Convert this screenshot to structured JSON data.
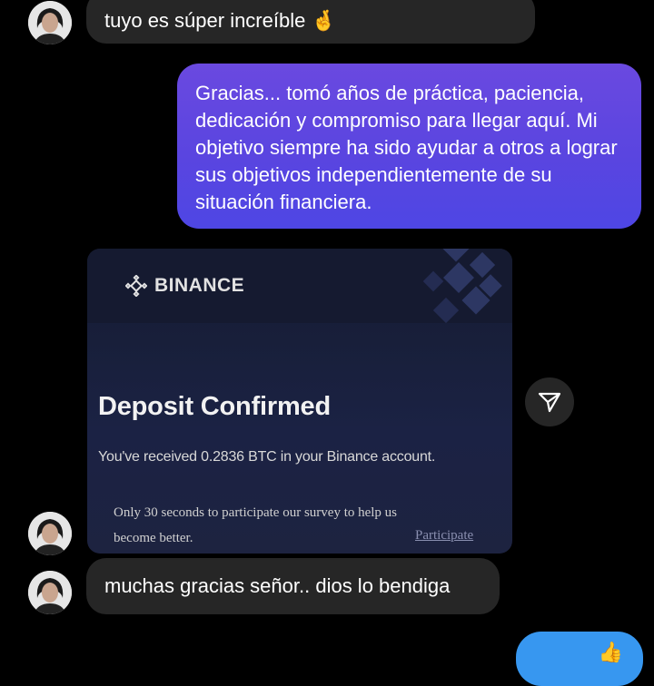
{
  "messages": {
    "incoming_1": "tuyo es súper increíble 🤞",
    "outgoing_1": "Gracias... tomó años de práctica, paciencia, dedicación y compromiso para llegar aquí. Mi objetivo siempre ha sido ayudar a otros a lograr sus objetivos independientemente de su situación financiera.",
    "incoming_2": "muchas gracias señor.. dios lo bendiga"
  },
  "shared_image": {
    "brand": "BINANCE",
    "title": "Deposit Confirmed",
    "body": "You've received 0.2836 BTC in your Binance account.",
    "survey": "Only 30 seconds to participate our survey to help us become better.",
    "link": "Participate"
  },
  "icons": {
    "share": "paper-plane-icon",
    "avatar": "user-avatar"
  },
  "colors": {
    "background": "#000000",
    "incoming_bubble": "#262626",
    "outgoing_gradient_top": "#6a49e0",
    "outgoing_gradient_bottom": "#4e46e4",
    "own_reply_bubble": "#3797f0",
    "binance_card": "#1b2244"
  }
}
